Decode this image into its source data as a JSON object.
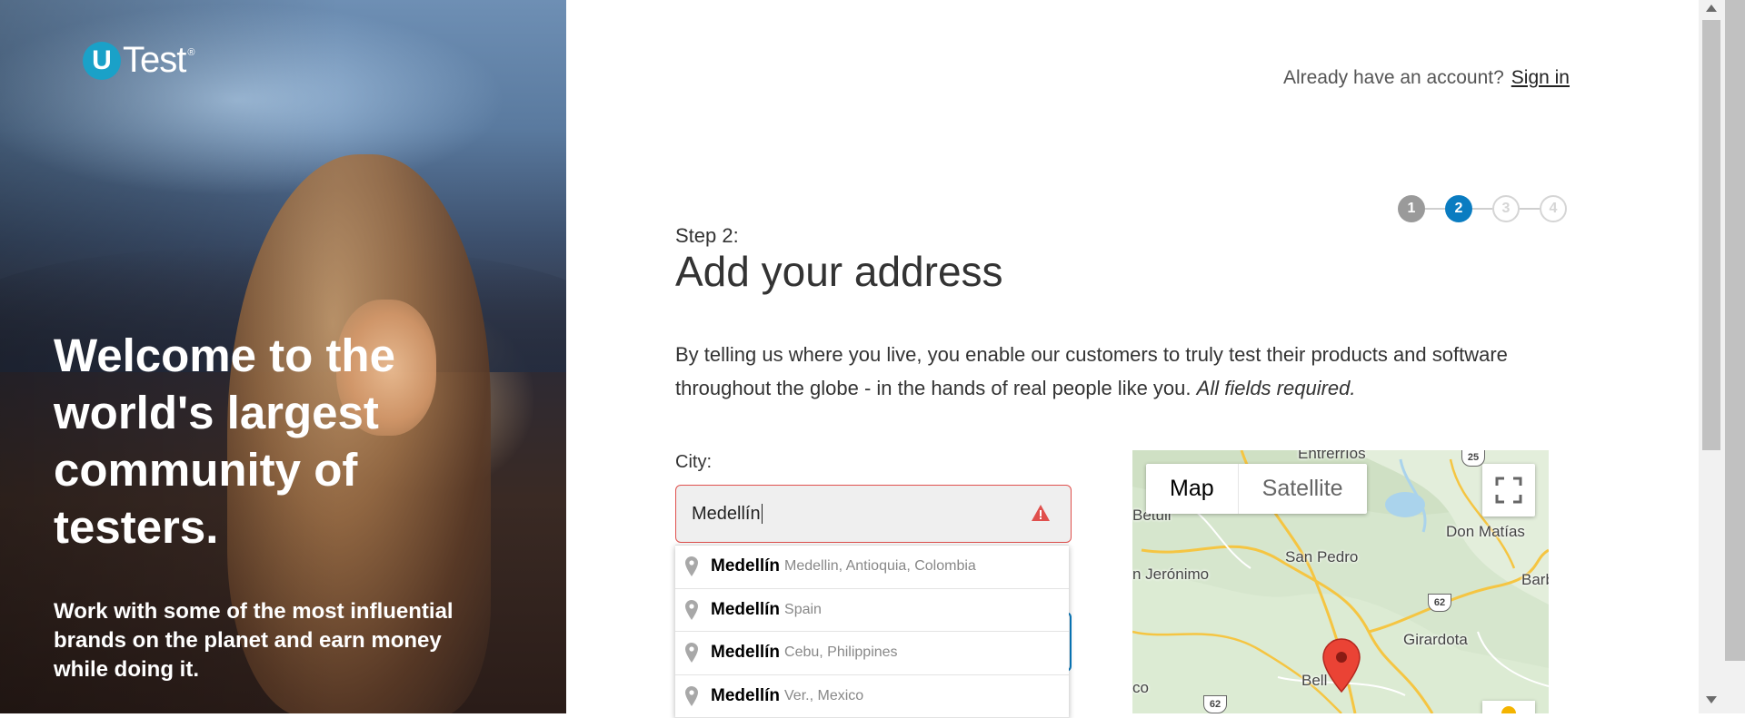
{
  "brand": {
    "logo_letter": "U",
    "logo_word": "Test",
    "logo_reg": "®"
  },
  "hero": {
    "title": "Welcome to the world's largest community of testers.",
    "subtitle": "Work with some of the most influential brands on the planet and earn money while doing it."
  },
  "header": {
    "already_text": "Already have an account?",
    "signin_label": "Sign in"
  },
  "steps": [
    "1",
    "2",
    "3",
    "4"
  ],
  "form": {
    "step_label": "Step 2:",
    "title": "Add your address",
    "intro": "By telling us where you live, you enable our customers to truly test their products and software throughout the globe - in the hands of real people like you.",
    "intro_required": "All fields required.",
    "city_label": "City:",
    "city_value": "Medellín"
  },
  "suggestions": [
    {
      "main": "Medellín",
      "rest": "Medellin, Antioquia, Colombia"
    },
    {
      "main": "Medellín",
      "rest": "Spain"
    },
    {
      "main": "Medellín",
      "rest": "Cebu, Philippines"
    },
    {
      "main": "Medellín",
      "rest": "Ver., Mexico"
    }
  ],
  "map": {
    "map_label": "Map",
    "satellite_label": "Satellite",
    "places": {
      "entrerrios": "Entrerríos",
      "san_pedro": "San Pedro",
      "don_matias": "Don Matías",
      "jeronimo": "n Jerónimo",
      "barb": "Barb",
      "girardota": "Girardota",
      "bello": "Bell",
      "co": "co",
      "betulia": "Betuli"
    },
    "routes": {
      "r25": "25",
      "r62a": "62",
      "r62b": "62"
    }
  },
  "colors": {
    "accent": "#0a7cc1",
    "error": "#e0504d",
    "logo": "#1aa1c8"
  }
}
